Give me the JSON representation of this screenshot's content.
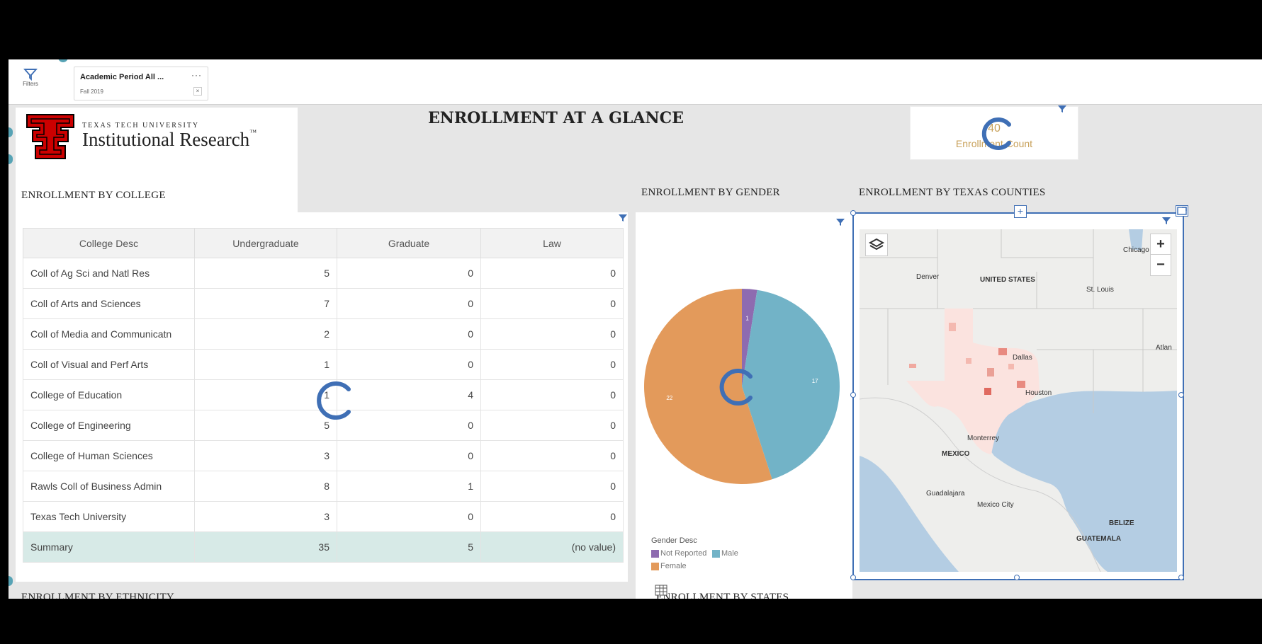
{
  "filter_bar": {
    "filters_label": "Filters",
    "chip": {
      "title": "Academic Period All ...",
      "value": "Fall 2019",
      "more": "···",
      "clear": "×"
    }
  },
  "header": {
    "logo_small": "TEXAS TECH UNIVERSITY",
    "logo_big": "Institutional Research",
    "logo_tm": "™",
    "page_title": "ENROLLMENT AT A GLANCE",
    "count_value": "40",
    "count_label": "Enrollment Count"
  },
  "sections": {
    "college": "ENROLLMENT BY COLLEGE",
    "gender": "ENROLLMENT BY GENDER",
    "counties": "ENROLLMENT BY TEXAS COUNTIES",
    "ethnicity": "ENROLLMENT BY ETHNICITY",
    "states": "ENROLLMENT BY STATES"
  },
  "college_table": {
    "headers": [
      "College Desc",
      "Undergraduate",
      "Graduate",
      "Law"
    ],
    "rows": [
      [
        "Coll of Ag Sci and Natl Res",
        "5",
        "0",
        "0"
      ],
      [
        "Coll of Arts and Sciences",
        "7",
        "0",
        "0"
      ],
      [
        "Coll of Media and Communicatn",
        "2",
        "0",
        "0"
      ],
      [
        "Coll of Visual and Perf Arts",
        "1",
        "0",
        "0"
      ],
      [
        "College of Education",
        "1",
        "4",
        "0"
      ],
      [
        "College of Engineering",
        "5",
        "0",
        "0"
      ],
      [
        "College of Human Sciences",
        "3",
        "0",
        "0"
      ],
      [
        "Rawls Coll of Business Admin",
        "8",
        "1",
        "0"
      ],
      [
        "Texas Tech University",
        "3",
        "0",
        "0"
      ]
    ],
    "summary": [
      "Summary",
      "35",
      "5",
      "(no value)"
    ]
  },
  "chart_data": {
    "type": "pie",
    "title": "",
    "legend_title": "Gender Desc",
    "slices": [
      {
        "name": "Not Reported",
        "value": 1,
        "color": "#8e6bb0"
      },
      {
        "name": "Male",
        "value": 17,
        "color": "#72b3c7"
      },
      {
        "name": "Female",
        "value": 22,
        "color": "#e39a5b"
      }
    ],
    "legend_placement": "bottom-left"
  },
  "map": {
    "labels": {
      "chicago": "Chicago",
      "denver": "Denver",
      "us": "UNITED STATES",
      "stlouis": "St. Louis",
      "dallas": "Dallas",
      "houston": "Houston",
      "atlan": "Atlan",
      "monterrey": "Monterrey",
      "mexico": "MEXICO",
      "guadalajara": "Guadalajara",
      "mexicocity": "Mexico City",
      "belize": "BELIZE",
      "guatemala": "GUATEMALA"
    },
    "zoom_in": "+",
    "zoom_out": "−",
    "move": "+"
  },
  "colors": {
    "accent": "#3f6fb5",
    "funnel": "#3f6fb5",
    "spinner": "#3f6fb5",
    "summary_row": "#d7eae7",
    "count_text": "#c8a15a"
  }
}
